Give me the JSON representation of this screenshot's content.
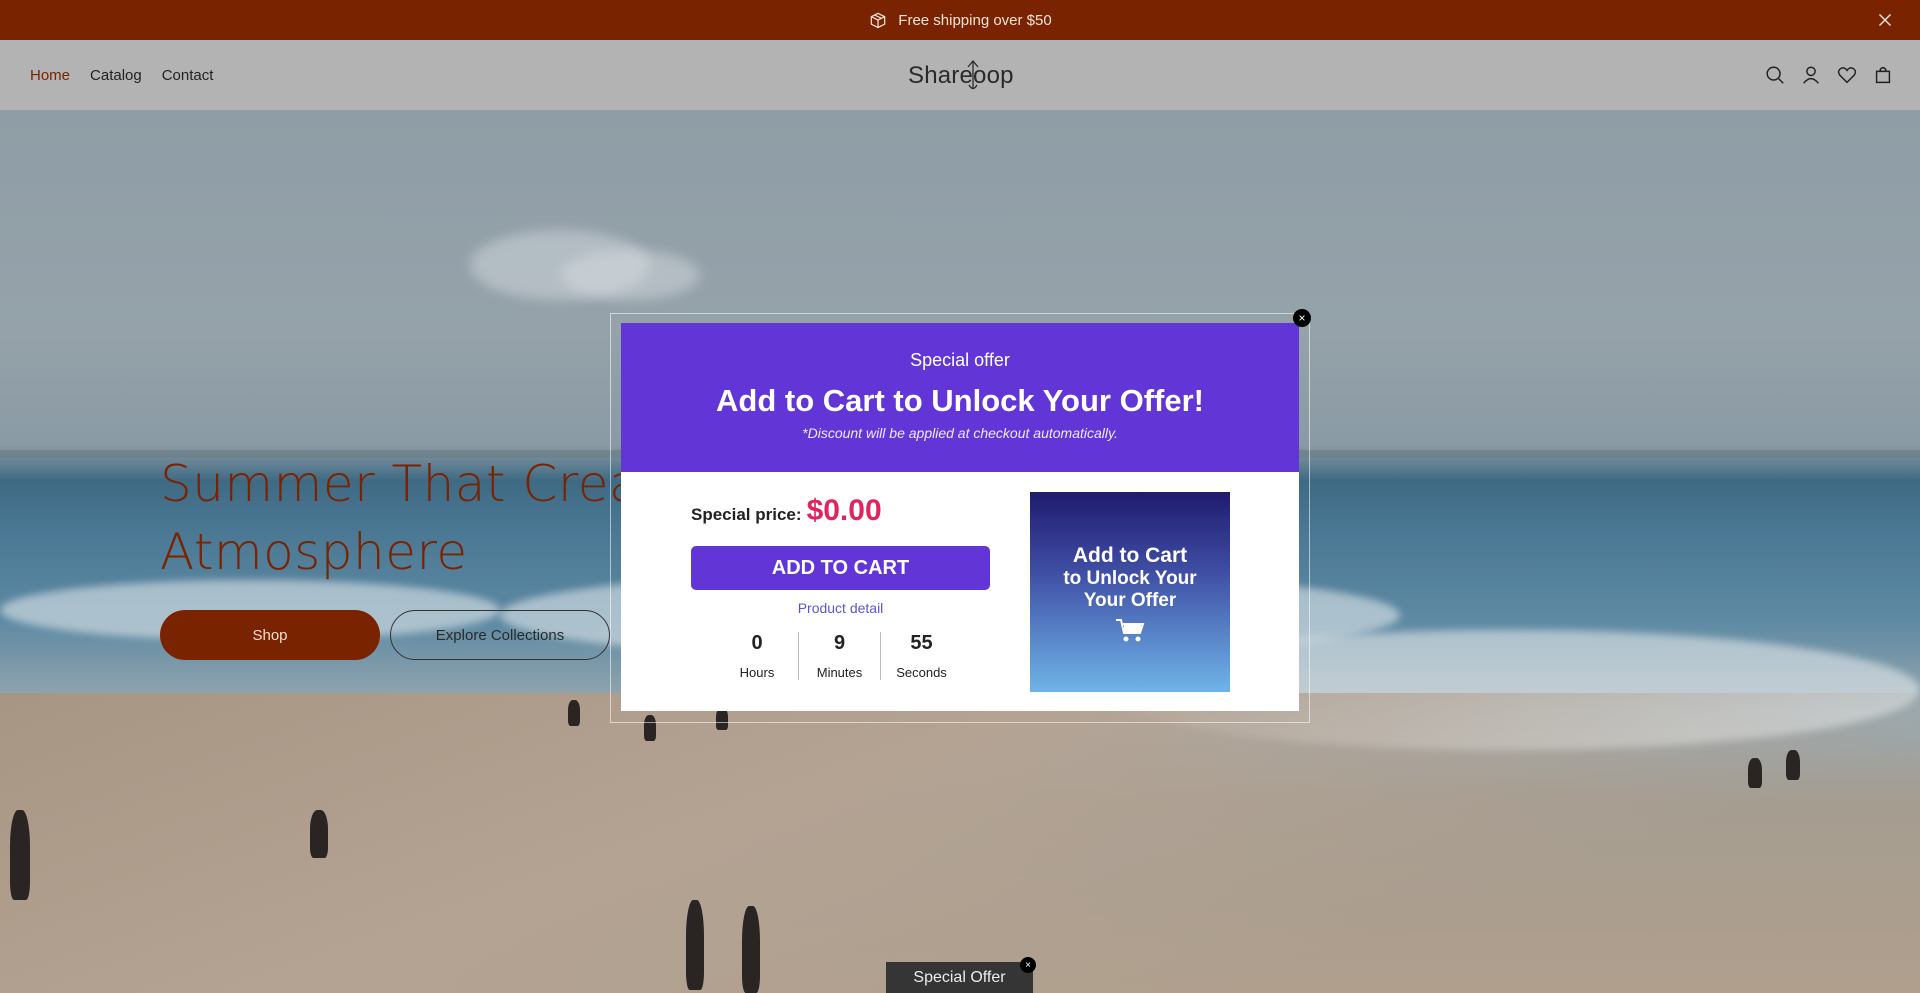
{
  "announcement": {
    "text": "Free shipping over $50",
    "icon": "gift-box-icon",
    "close_icon": "close-icon"
  },
  "header": {
    "nav": [
      {
        "label": "Home",
        "active": true
      },
      {
        "label": "Catalog",
        "active": false
      },
      {
        "label": "Contact",
        "active": false
      }
    ],
    "logo": "Shareoop",
    "icons": [
      "search-icon",
      "account-icon",
      "wishlist-icon",
      "cart-icon"
    ]
  },
  "hero": {
    "title_line1": "Summer That Creat",
    "title_line2": "Atmosphere",
    "shop_label": "Shop",
    "explore_label": "Explore Collections"
  },
  "popup": {
    "eyebrow": "Special offer",
    "headline": "Add to Cart to Unlock Your Offer!",
    "note": "*Discount will be applied at checkout automatically.",
    "price_label": "Special price:",
    "price_value": "$0.00",
    "add_to_cart": "ADD TO CART",
    "detail_link": "Product detail",
    "countdown": [
      {
        "value": "0",
        "unit": "Hours"
      },
      {
        "value": "9",
        "unit": "Minutes"
      },
      {
        "value": "55",
        "unit": "Seconds"
      }
    ],
    "image_text": {
      "line1": "Add to Cart",
      "line2": "to Unlock Your",
      "line3": "Your Offer"
    },
    "close_glyph": "×"
  },
  "offer_tab": {
    "label": "Special Offer",
    "close_glyph": "×"
  },
  "colors": {
    "brand": "#7a2300",
    "popup_accent": "#6236d6",
    "price": "#e0245e"
  }
}
